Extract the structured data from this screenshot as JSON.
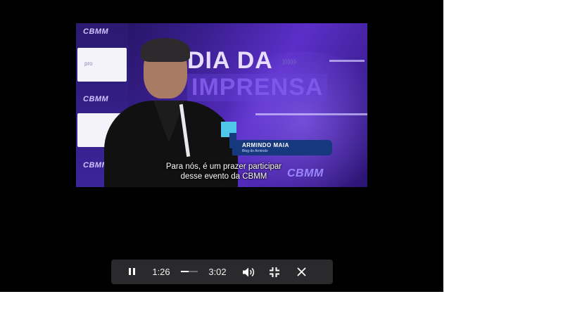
{
  "video": {
    "logos": [
      "CBMM",
      "CBMM",
      "CBMM",
      "CBMM"
    ],
    "card_text": "pro",
    "headline_line1": "DIA DA",
    "headline_line2": "IMPRENSA",
    "lower_third": {
      "name": "ARMINDO MAIA",
      "role": "Blog do Armindo"
    },
    "subtitle_line1": "Para nós, é um prazer participar",
    "subtitle_line2": "desse evento da CBMM"
  },
  "controls": {
    "current_time": "1:26",
    "duration": "3:02",
    "progress_fraction": 0.47,
    "icons": {
      "pause": "pause-icon",
      "volume": "volume-icon",
      "exit_fullscreen": "exit-fullscreen-icon",
      "close": "close-icon"
    }
  },
  "colors": {
    "stage_bg": "#000000",
    "control_bar_bg": "#2a2a2c",
    "lower_third_bg": "#16387c",
    "lower_third_accent": "#4fc6ea"
  }
}
